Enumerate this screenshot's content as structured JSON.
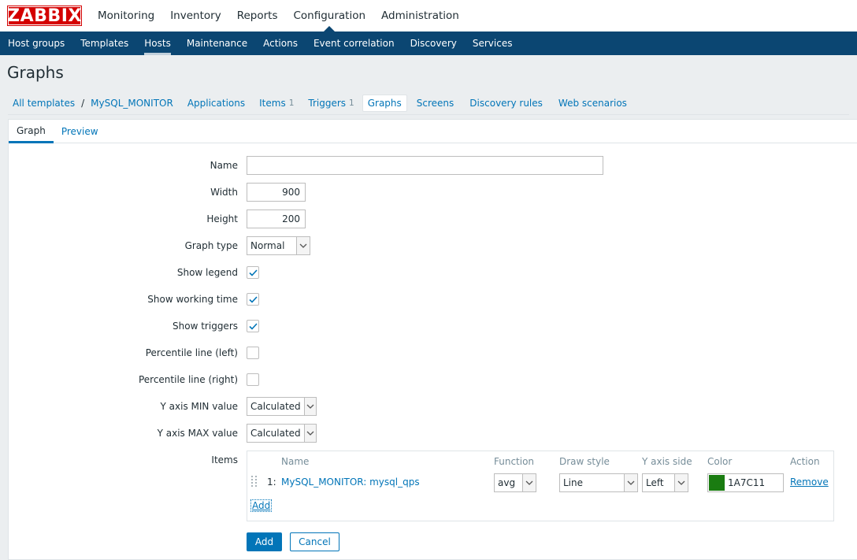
{
  "app": {
    "logo": "ZABBIX"
  },
  "top_menu": [
    "Monitoring",
    "Inventory",
    "Reports",
    "Configuration",
    "Administration"
  ],
  "sub_menu": [
    "Host groups",
    "Templates",
    "Hosts",
    "Maintenance",
    "Actions",
    "Event correlation",
    "Discovery",
    "Services"
  ],
  "page_title": "Graphs",
  "breadcrumb": {
    "all_templates": "All templates",
    "separator": "/",
    "template": "MySQL_MONITOR",
    "applications": "Applications",
    "items": "Items",
    "items_count": "1",
    "triggers": "Triggers",
    "triggers_count": "1",
    "graphs": "Graphs",
    "screens": "Screens",
    "discovery_rules": "Discovery rules",
    "web_scenarios": "Web scenarios"
  },
  "form_tabs": {
    "graph": "Graph",
    "preview": "Preview"
  },
  "form": {
    "name_label": "Name",
    "name_value": "",
    "width_label": "Width",
    "width_value": "900",
    "height_label": "Height",
    "height_value": "200",
    "graph_type_label": "Graph type",
    "graph_type_value": "Normal",
    "show_legend_label": "Show legend",
    "show_working_time_label": "Show working time",
    "show_triggers_label": "Show triggers",
    "percentile_left_label": "Percentile line (left)",
    "percentile_right_label": "Percentile line (right)",
    "ymin_label": "Y axis MIN value",
    "ymin_value": "Calculated",
    "ymax_label": "Y axis MAX value",
    "ymax_value": "Calculated",
    "items_label": "Items"
  },
  "items_table": {
    "headers": {
      "name": "Name",
      "function": "Function",
      "draw_style": "Draw style",
      "y_axis_side": "Y axis side",
      "color": "Color",
      "action": "Action"
    },
    "rows": [
      {
        "index": "1:",
        "name": "MySQL_MONITOR: mysql_qps",
        "function": "avg",
        "draw_style": "Line",
        "y_axis_side": "Left",
        "color": "1A7C11",
        "color_hex": "#1A7C11",
        "action": "Remove"
      }
    ],
    "add_link": "Add"
  },
  "buttons": {
    "add": "Add",
    "cancel": "Cancel"
  },
  "colors": {
    "brand": "#d40000",
    "nav": "#0b4672",
    "link": "#0275b8"
  }
}
